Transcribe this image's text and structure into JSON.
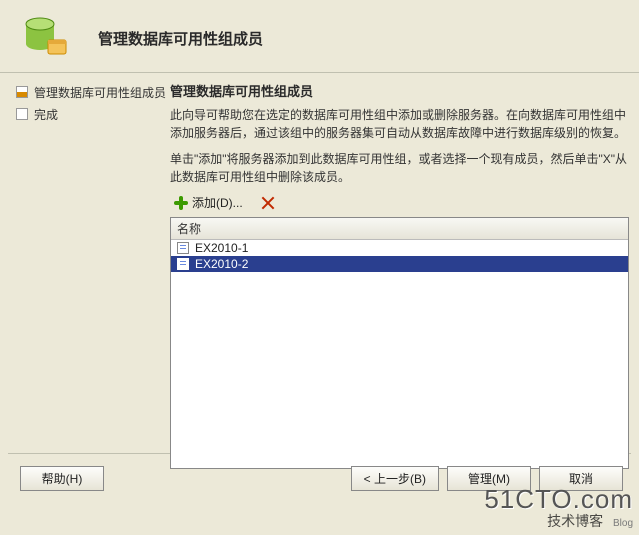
{
  "header": {
    "title": "管理数据库可用性组成员"
  },
  "sidebar": {
    "steps": [
      {
        "label": "管理数据库可用性组成员",
        "state": "current"
      },
      {
        "label": "完成",
        "state": "pending"
      }
    ]
  },
  "main": {
    "section_title": "管理数据库可用性组成员",
    "description": "此向导可帮助您在选定的数据库可用性组中添加或删除服务器。在向数据库可用性组中添加服务器后，通过该组中的服务器集可自动从数据库故障中进行数据库级别的恢复。",
    "hint": "单击\"添加\"将服务器添加到此数据库可用性组，或者选择一个现有成员，然后单击\"X\"从此数据库可用性组中删除该成员。",
    "toolbar": {
      "add_label": "添加(D)..."
    },
    "list": {
      "column_header": "名称",
      "items": [
        {
          "name": "EX2010-1",
          "selected": false
        },
        {
          "name": "EX2010-2",
          "selected": true
        }
      ]
    }
  },
  "footer": {
    "help_label": "帮助(H)",
    "back_label": "< 上一步(B)",
    "manage_label": "管理(M)",
    "cancel_label": "取消"
  },
  "watermark": {
    "brand": "51CTO.com",
    "sub": "技术博客",
    "tag": "Blog"
  }
}
